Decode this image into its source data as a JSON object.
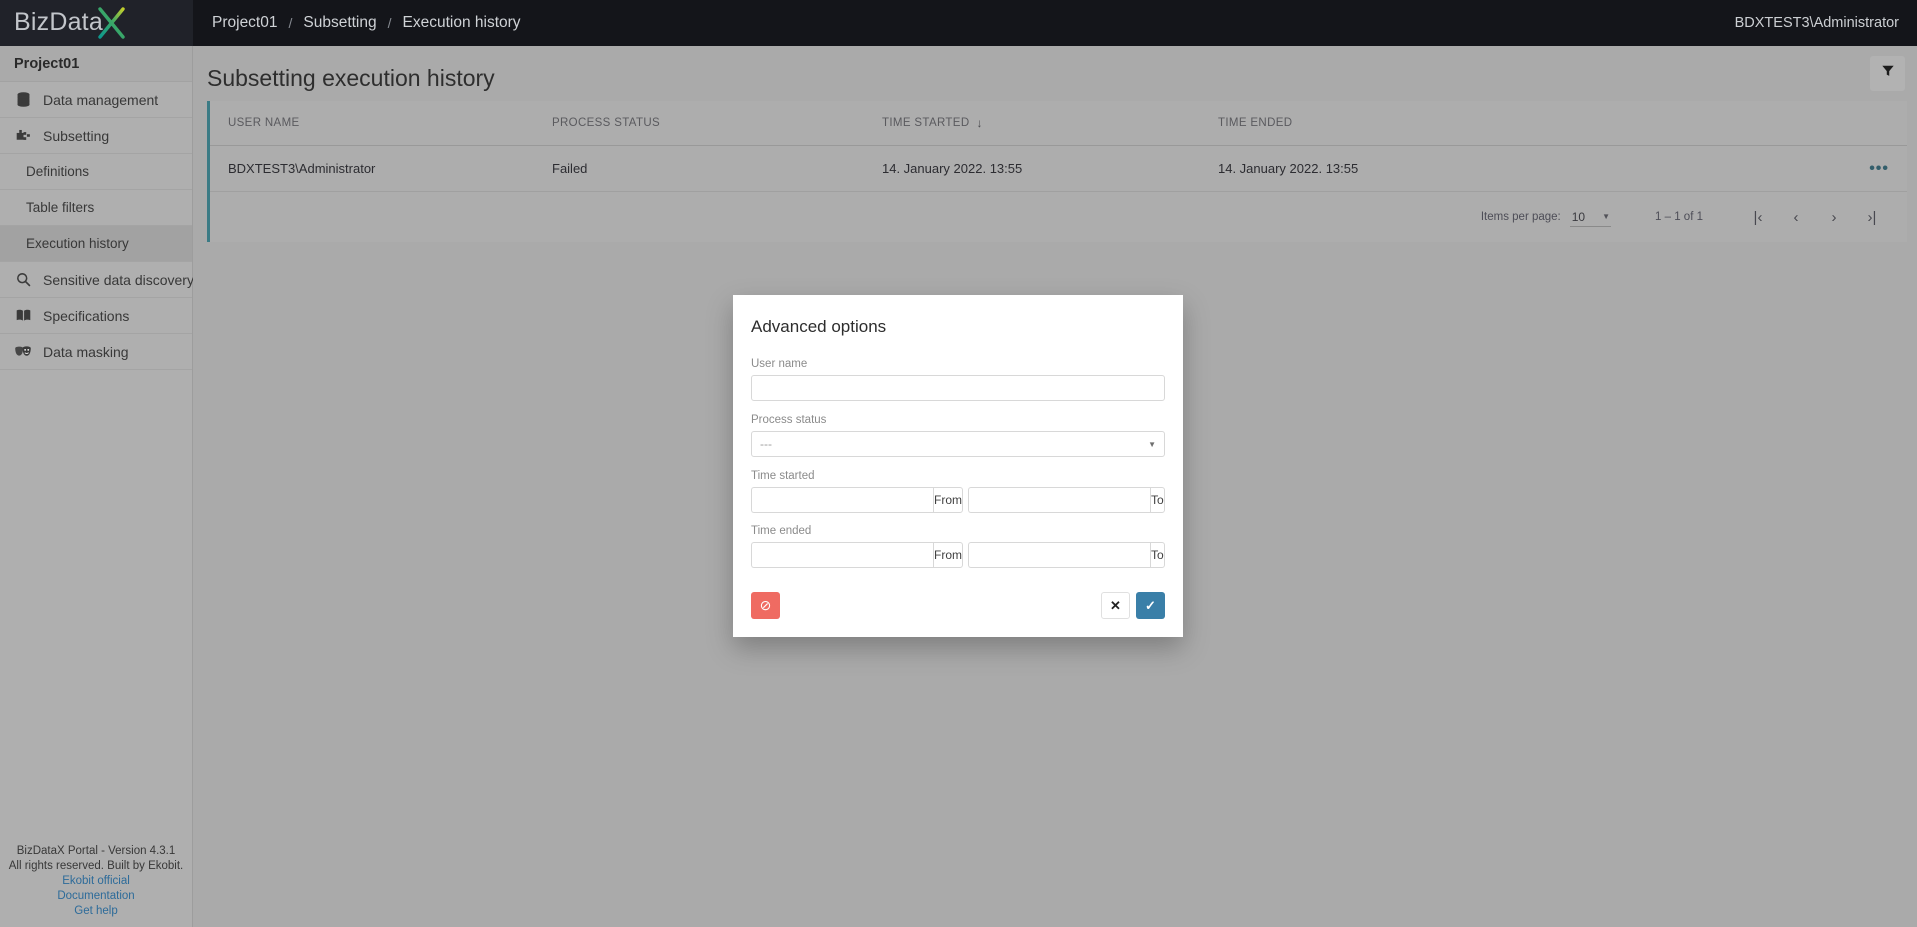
{
  "topbar": {
    "logo_text": "BizData",
    "logo_mark": "X",
    "breadcrumb": [
      "Project01",
      "Subsetting",
      "Execution history"
    ],
    "breadcrumb_separator": "/",
    "user": "BDXTEST3\\Administrator"
  },
  "sidebar": {
    "project": "Project01",
    "items": [
      {
        "label": "Data management",
        "icon": "database-icon",
        "sub": false,
        "active": false
      },
      {
        "label": "Subsetting",
        "icon": "subsetting-icon",
        "sub": false,
        "active": false
      },
      {
        "label": "Definitions",
        "icon": "",
        "sub": true,
        "active": false
      },
      {
        "label": "Table filters",
        "icon": "",
        "sub": true,
        "active": false
      },
      {
        "label": "Execution history",
        "icon": "",
        "sub": true,
        "active": true
      },
      {
        "label": "Sensitive data discovery",
        "icon": "search-icon",
        "sub": false,
        "active": false
      },
      {
        "label": "Specifications",
        "icon": "book-icon",
        "sub": false,
        "active": false
      },
      {
        "label": "Data masking",
        "icon": "masks-icon",
        "sub": false,
        "active": false
      }
    ],
    "footer": {
      "version": "BizDataX Portal - Version 4.3.1",
      "rights": "All rights reserved. Built by Ekobit.",
      "links": [
        "Ekobit official",
        "Documentation",
        "Get help"
      ]
    }
  },
  "main": {
    "title": "Subsetting execution history",
    "filter_icon": "filter-icon",
    "table": {
      "columns": [
        "USER NAME",
        "PROCESS STATUS",
        "TIME STARTED",
        "TIME ENDED"
      ],
      "sorted_column": "TIME STARTED",
      "sort_indicator": "↓",
      "rows": [
        {
          "user_name": "BDXTEST3\\Administrator",
          "process_status": "Failed",
          "time_started": "14. January 2022. 13:55",
          "time_ended": "14. January 2022. 13:55",
          "menu": "•••"
        }
      ]
    },
    "paginator": {
      "items_per_page_label": "Items per page:",
      "items_per_page_value": "10",
      "range_label": "1 – 1 of 1",
      "first_label": "|‹",
      "prev_label": "‹",
      "next_label": "›",
      "last_label": "›|"
    }
  },
  "dialog": {
    "title": "Advanced options",
    "user_name": {
      "label": "User name",
      "value": "",
      "placeholder": ""
    },
    "process_status": {
      "label": "Process status",
      "value": "---"
    },
    "time_started": {
      "label": "Time started",
      "from": {
        "value": "",
        "suffix": "From"
      },
      "to": {
        "value": "",
        "suffix": "To"
      }
    },
    "time_ended": {
      "label": "Time ended",
      "from": {
        "value": "",
        "suffix": "From"
      },
      "to": {
        "value": "",
        "suffix": "To"
      }
    },
    "buttons": {
      "clear": {
        "icon": "block-icon",
        "glyph": "⊘",
        "color": "#ef6b62"
      },
      "cancel": {
        "glyph": "✕"
      },
      "confirm": {
        "glyph": "✓",
        "color": "#3a7fa8"
      }
    }
  }
}
